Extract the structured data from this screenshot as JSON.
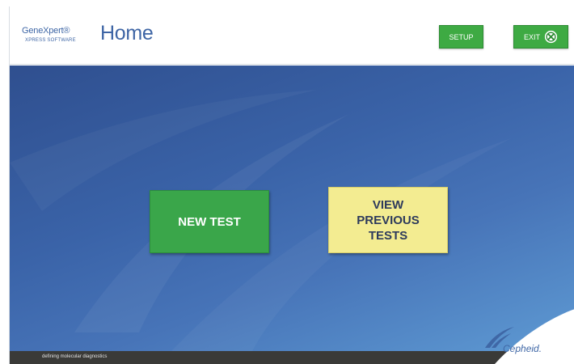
{
  "header": {
    "logo_name": "GeneXpert®",
    "logo_sub": "XPRESS SOFTWARE",
    "title": "Home",
    "setup_label": "SETUP",
    "exit_label": "EXIT",
    "exit_icon": "close-circle-icon"
  },
  "main": {
    "new_test_label": "NEW TEST",
    "view_previous_label": "VIEW\nPREVIOUS\nTESTS"
  },
  "footer": {
    "tagline": "defining molecular diagnostics",
    "brand": "Cepheid."
  },
  "colors": {
    "accent_green": "#3eaa43",
    "accent_yellow": "#f3ec91",
    "header_blue": "#3e65a5",
    "background_blue": "#3a63a8",
    "footer_dark": "#3a3a38"
  }
}
